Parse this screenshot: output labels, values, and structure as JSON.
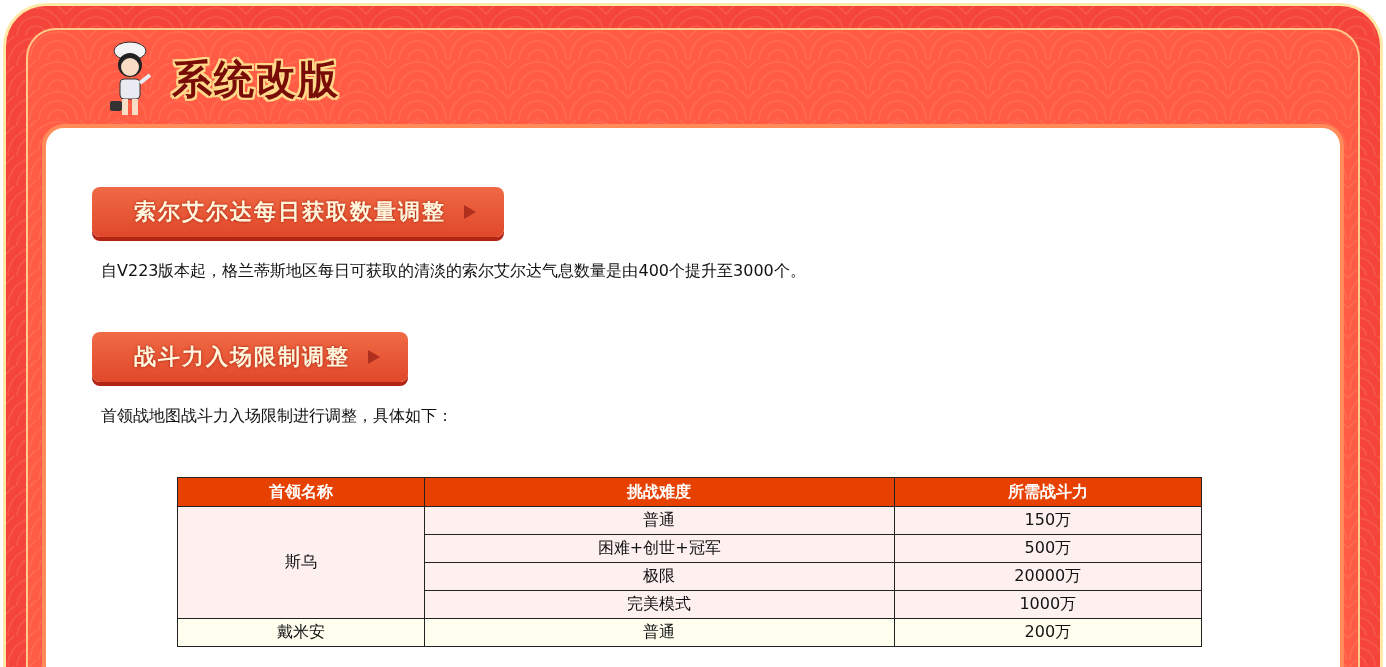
{
  "header": {
    "title": "系统改版"
  },
  "sections": [
    {
      "heading": "索尔艾尔达每日获取数量调整",
      "paragraphs": [
        "自V223版本起，格兰蒂斯地区每日可获取的清淡的索尔艾尔达气息数量是由400个提升至3000个。"
      ]
    },
    {
      "heading": "战斗力入场限制调整",
      "paragraphs": [
        "首领战地图战斗力入场限制进行调整，具体如下："
      ],
      "table": {
        "columns": [
          "首领名称",
          "挑战难度",
          "所需战斗力"
        ],
        "bosses": [
          {
            "name": "斯乌",
            "rows": [
              {
                "difficulty": "普通",
                "power": "150万"
              },
              {
                "difficulty": "困难+创世+冠军",
                "power": "500万"
              },
              {
                "difficulty": "极限",
                "power": "20000万"
              },
              {
                "difficulty": "完美模式",
                "power": "1000万"
              }
            ]
          },
          {
            "name": "戴米安",
            "rows": [
              {
                "difficulty": "普通",
                "power": "200万"
              }
            ]
          }
        ]
      }
    }
  ]
}
